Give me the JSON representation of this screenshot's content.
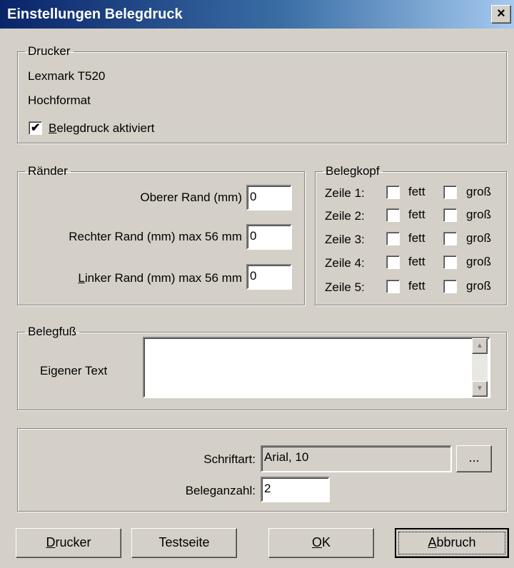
{
  "window": {
    "title": "Einstellungen Belegdruck",
    "close": "×"
  },
  "drucker": {
    "legend": "Drucker",
    "name": "Lexmark T520",
    "orientation": "Hochformat",
    "enabled": {
      "label_key": "B",
      "label_rest": "elegdruck aktiviert",
      "checked": true
    }
  },
  "raender": {
    "legend": "Ränder",
    "oben": {
      "label": "Oberer Rand (mm)",
      "value": "0"
    },
    "rechts": {
      "label": "Rechter Rand (mm) max 56 mm",
      "value": "0"
    },
    "links": {
      "label_key": "L",
      "label_rest": "inker Rand (mm) max 56 mm",
      "value": "0"
    }
  },
  "belegkopf": {
    "legend": "Belegkopf",
    "fett": "fett",
    "gross": "groß",
    "rows": [
      {
        "label": "Zeile 1:",
        "fett": false,
        "gross": false
      },
      {
        "label": "Zeile 2:",
        "fett": false,
        "gross": false
      },
      {
        "label": "Zeile 3:",
        "fett": false,
        "gross": false
      },
      {
        "label": "Zeile 4:",
        "fett": false,
        "gross": false
      },
      {
        "label": "Zeile 5:",
        "fett": false,
        "gross": false
      }
    ]
  },
  "belegfuss": {
    "legend": "Belegfuß",
    "label": "Eigener Text",
    "value": ""
  },
  "optionen": {
    "schriftart_label": "Schriftart:",
    "schriftart_value": "Arial, 10",
    "browse": "...",
    "anzahl_label": "Beleganzahl:",
    "anzahl_value": "2"
  },
  "buttons": {
    "drucker": {
      "key": "D",
      "rest": "rucker"
    },
    "testseite": "Testseite",
    "ok": {
      "key": "O",
      "rest": "K"
    },
    "abbruch": {
      "key": "A",
      "rest": "bbruch"
    }
  }
}
